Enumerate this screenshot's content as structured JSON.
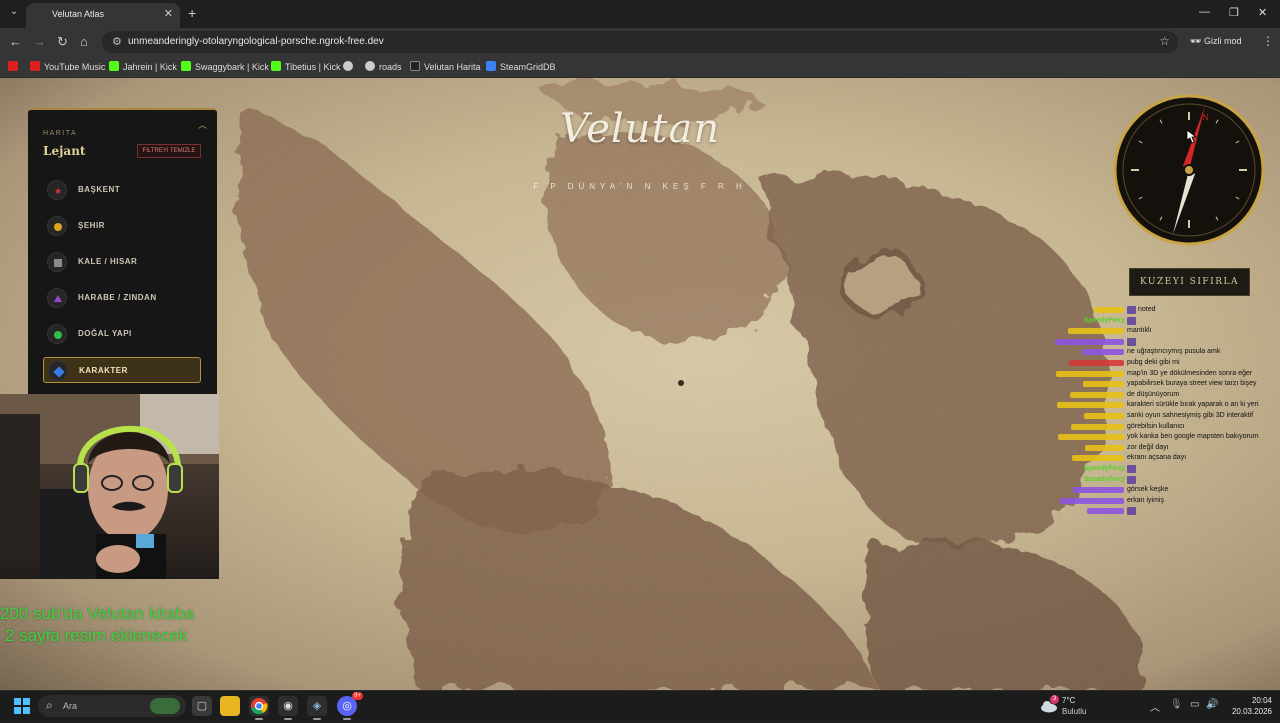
{
  "browser": {
    "tab_title": "Velutan Atlas",
    "tab_icon": "V",
    "url": "unmeanderingly-otolaryngological-porsche.ngrok-free.dev",
    "incognito_label": "Gizli mod",
    "bookmarks": [
      {
        "label": "",
        "icon": "youtube-icon",
        "color": "#e02020"
      },
      {
        "label": "YouTube Music",
        "icon": "youtube-music-icon",
        "color": "#e02020"
      },
      {
        "label": "Jahrein | Kick",
        "icon": "kick-icon",
        "color": "#53fc18"
      },
      {
        "label": "Swaggybark | Kick",
        "icon": "kick-icon",
        "color": "#53fc18"
      },
      {
        "label": "Tibetius | Kick",
        "icon": "kick-icon",
        "color": "#53fc18"
      },
      {
        "label": "",
        "icon": "globe-icon",
        "color": "#cccccc"
      },
      {
        "label": "roads",
        "icon": "roads-icon",
        "color": "#cccccc"
      },
      {
        "label": "Velutan Harita",
        "icon": "velutan-icon",
        "color": "#dddddd"
      },
      {
        "label": "SteamGridDB",
        "icon": "steamgriddb-icon",
        "color": "#3b82f6"
      }
    ]
  },
  "map": {
    "brand": "Velutan",
    "brand_subtitle": "F P DÜNYA'N N  KEŞ F  R H"
  },
  "legend": {
    "eyebrow": "HARITA",
    "title": "Lejant",
    "clear_filter": "FILTREYI TEMIZLE",
    "items": [
      {
        "label": "BAŞKENT",
        "marker": "star",
        "color": "#d23a3a",
        "active": false
      },
      {
        "label": "ŞEHIR",
        "marker": "circle",
        "color": "#e0a21f",
        "active": false
      },
      {
        "label": "KALE / HISAR",
        "marker": "square",
        "color": "#8a8a8a",
        "active": false
      },
      {
        "label": "HARABE / ZINDAN",
        "marker": "triangle",
        "color": "#9a4ad0",
        "active": false
      },
      {
        "label": "DOĞAL YAPI",
        "marker": "circle",
        "color": "#2fbf4a",
        "active": false
      },
      {
        "label": "KARAKTER",
        "marker": "diamond",
        "color": "#3a7be0",
        "active": true
      }
    ]
  },
  "compass": {
    "reset_label": "KUZEYI SIFIRLA",
    "north_letter": "N"
  },
  "overlay": {
    "line1": "200 sub'da Velutan kitaba",
    "line2": "2 sayfa resim eklenecek"
  },
  "chat": [
    {
      "user": "",
      "color": "#e7c117",
      "emote": true,
      "msg": "noted"
    },
    {
      "user": "SpeedyFoxy",
      "color": "#5bd12a",
      "emote": true,
      "msg": ""
    },
    {
      "user": "",
      "color": "#e7c117",
      "emote": false,
      "msg": "mantıklı"
    },
    {
      "user": "",
      "color": "#8c54e0",
      "emote": true,
      "msg": ""
    },
    {
      "user": "",
      "color": "#8c54e0",
      "emote": false,
      "msg": "ne uğraştırıcıymış pusula amk"
    },
    {
      "user": "",
      "color": "#d43a3a",
      "emote": false,
      "msg": "pubg deki gibi mi"
    },
    {
      "user": "",
      "color": "#e7c117",
      "emote": false,
      "msg": "map'in 3D ye dökülmesinden sonra eğer"
    },
    {
      "user": "",
      "color": "#e7c117",
      "emote": false,
      "msg": "yapabilirsek buraya street view tarzı bişey"
    },
    {
      "user": "",
      "color": "#e7c117",
      "emote": false,
      "msg": "de düşünüyorum"
    },
    {
      "user": "",
      "color": "#e7c117",
      "emote": false,
      "msg": "karakteri sürükle bırak yaparak o an ki yeri"
    },
    {
      "user": "",
      "color": "#e7c117",
      "emote": false,
      "msg": "sanki oyun sahnesiymiş gibi 3D interaktif"
    },
    {
      "user": "",
      "color": "#e7c117",
      "emote": false,
      "msg": "görebilsin kullanıcı"
    },
    {
      "user": "",
      "color": "#e7c117",
      "emote": false,
      "msg": "yok kanka ben google mapsten bakıyorum"
    },
    {
      "user": "",
      "color": "#e7c117",
      "emote": false,
      "msg": "zor değil dayı"
    },
    {
      "user": "",
      "color": "#e7c117",
      "emote": false,
      "msg": "ekranı açsana dayı"
    },
    {
      "user": "SpeedyFoxy",
      "color": "#5bd12a",
      "emote": true,
      "msg": ""
    },
    {
      "user": "SpeedyFoxy",
      "color": "#5bd12a",
      "emote": true,
      "msg": ""
    },
    {
      "user": "",
      "color": "#8c54e0",
      "emote": false,
      "msg": "görsek keşke"
    },
    {
      "user": "",
      "color": "#8c54e0",
      "emote": false,
      "msg": "erkan iyimiş"
    },
    {
      "user": "",
      "color": "#8c54e0",
      "emote": true,
      "msg": ""
    }
  ],
  "taskbar": {
    "search_placeholder": "Ara",
    "weather_temp": "7°C",
    "weather_condition": "Bulutlu",
    "weather_badge": "3",
    "discord_badge": "9+",
    "time": "20:04",
    "date": "20.03.2026"
  }
}
